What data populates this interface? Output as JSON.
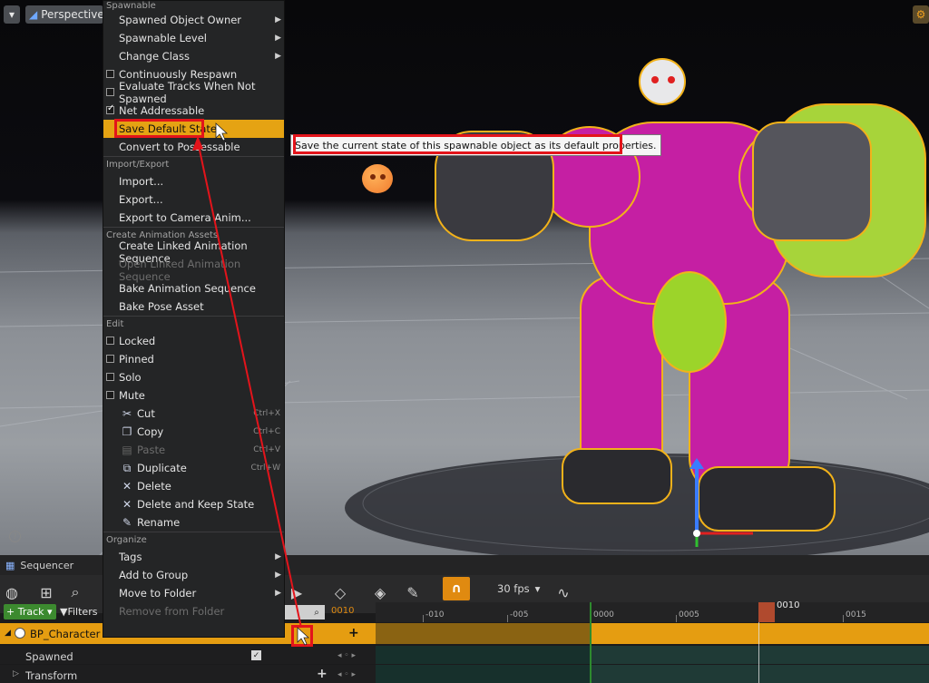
{
  "viewport": {
    "perspective_label": "Perspective",
    "menu_icon": "chevron-down-icon",
    "help_icon": "?",
    "tooltip": "Save the current state of this spawnable object as its default properties."
  },
  "context_menu": {
    "sections": {
      "spawnable": "Spawnable",
      "import_export": "Import/Export",
      "create_animation_assets": "Create Animation Assets",
      "edit": "Edit",
      "organize": "Organize"
    },
    "spawnable_items": {
      "spawned_object_owner": "Spawned Object Owner",
      "spawnable_level": "Spawnable Level",
      "change_class": "Change Class",
      "continuously_respawn": "Continuously Respawn",
      "evaluate_tracks": "Evaluate Tracks When Not Spawned",
      "net_addressable": "Net Addressable",
      "save_default_state": "Save Default State",
      "convert_to_possessable": "Convert to Possessable"
    },
    "import_export_items": {
      "import": "Import...",
      "export": "Export...",
      "export_camera_anim": "Export to Camera Anim..."
    },
    "animation_items": {
      "create_linked": "Create Linked Animation Sequence",
      "open_linked": "Open Linked Animation Sequence",
      "bake_animation": "Bake Animation Sequence",
      "bake_pose": "Bake Pose Asset"
    },
    "edit_items": {
      "locked": "Locked",
      "pinned": "Pinned",
      "solo": "Solo",
      "mute": "Mute",
      "cut": "Cut",
      "cut_shortcut": "Ctrl+X",
      "copy": "Copy",
      "copy_shortcut": "Ctrl+C",
      "paste": "Paste",
      "paste_shortcut": "Ctrl+V",
      "duplicate": "Duplicate",
      "duplicate_shortcut": "Ctrl+W",
      "delete": "Delete",
      "delete_keep": "Delete and Keep State",
      "rename": "Rename"
    },
    "organize_items": {
      "tags": "Tags",
      "add_to_group": "Add to Group",
      "move_to_folder": "Move to Folder",
      "remove_from_folder": "Remove from Folder"
    }
  },
  "sequencer": {
    "tab_label": "Sequencer",
    "fps": "30 fps",
    "add_track": "Track",
    "filters": "Filters",
    "current_frame": "0010",
    "playhead_frame": "0010",
    "ruler_ticks": [
      "-010",
      "-005",
      "0000",
      "0005",
      "0015"
    ],
    "tracks": {
      "character": "BP_Character",
      "spawned": "Spawned",
      "transform": "Transform"
    },
    "colors": {
      "accent": "#e59d11",
      "track_add": "#3c8a2f"
    }
  }
}
